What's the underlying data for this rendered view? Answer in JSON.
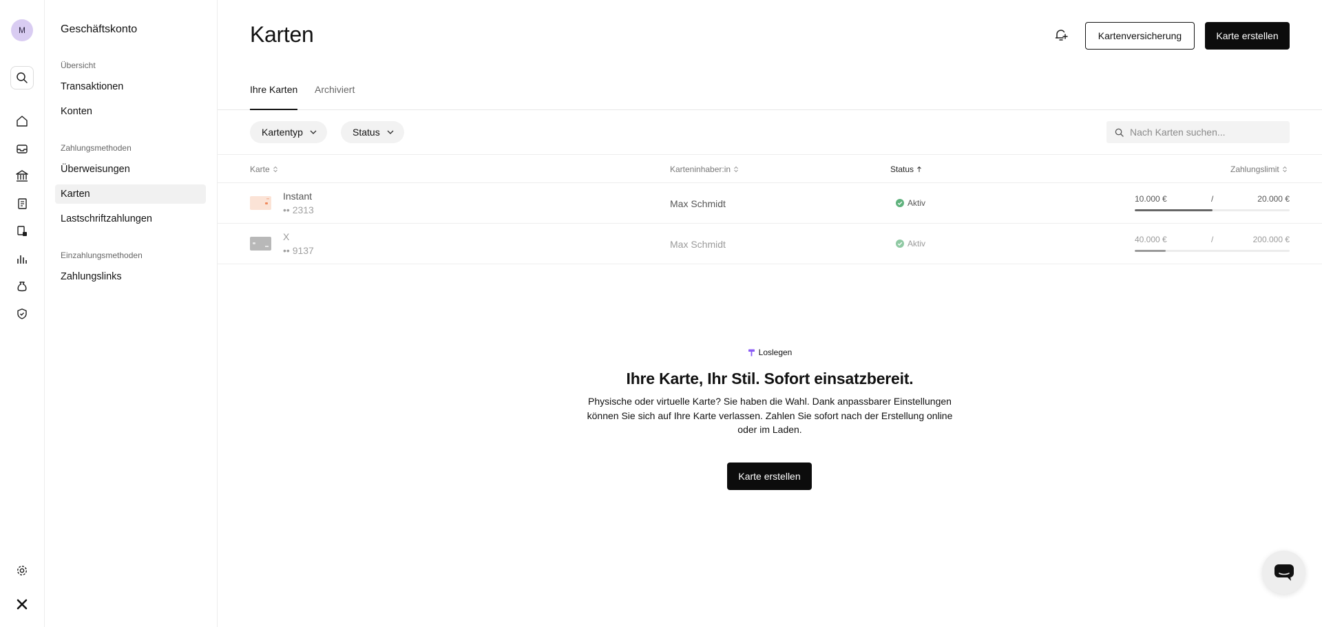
{
  "rail": {
    "avatar_initial": "M",
    "icons": [
      "search-icon",
      "home-icon",
      "inbox-icon",
      "bank-icon",
      "invoice-icon",
      "documents-lock-icon",
      "chart-icon",
      "money-bag-icon",
      "shield-icon",
      "settings-icon",
      "logo-icon"
    ]
  },
  "nav": {
    "title": "Geschäftskonto",
    "overview": {
      "heading": "Übersicht",
      "items": [
        {
          "label": "Transaktionen"
        },
        {
          "label": "Konten"
        }
      ]
    },
    "payment": {
      "heading": "Zahlungsmethoden",
      "items": [
        {
          "label": "Überweisungen"
        },
        {
          "label": "Karten",
          "active": true
        },
        {
          "label": "Lastschriftzahlungen"
        }
      ]
    },
    "deposit": {
      "heading": "Einzahlungsmethoden",
      "items": [
        {
          "label": "Zahlungslinks"
        }
      ]
    }
  },
  "header": {
    "title": "Karten",
    "insurance_button": "Kartenversicherung",
    "create_button": "Karte erstellen"
  },
  "tabs": [
    {
      "label": "Ihre Karten",
      "active": true
    },
    {
      "label": "Archiviert"
    }
  ],
  "filters": {
    "card_type": "Kartentyp",
    "status": "Status",
    "search_placeholder": "Nach Karten suchen..."
  },
  "table": {
    "columns": {
      "card": "Karte",
      "holder": "Karteninhaber:in",
      "status": "Status",
      "limit": "Zahlungslimit"
    },
    "rows": [
      {
        "name": "Instant",
        "number": "•• 2313",
        "holder": "Max Schmidt",
        "status": "Aktiv",
        "used": "10.000 €",
        "sep": "/",
        "limit": "20.000 €",
        "progress": 0.5,
        "thumb_color": "#fbe3d6"
      },
      {
        "name": "X",
        "number": "•• 9137",
        "holder": "Max Schmidt",
        "status": "Aktiv",
        "used": "40.000 €",
        "sep": "/",
        "limit": "200.000 €",
        "progress": 0.2,
        "thumb_color": "#b8b8b8"
      }
    ]
  },
  "promo": {
    "eyebrow": "Loslegen",
    "title": "Ihre Karte, Ihr Stil. Sofort einsatzbereit.",
    "text": "Physische oder virtuelle Karte? Sie haben die Wahl. Dank anpassbarer Einstellungen können Sie sich auf Ihre Karte verlassen. Zahlen Sie sofort nach der Erstellung online oder im Laden.",
    "button": "Karte erstellen"
  },
  "colors": {
    "accent": "#0c0c0c",
    "status_ok": "#5fb27d",
    "avatar_bg": "#d9ccf2",
    "promo_icon": "#8b5cf6"
  }
}
